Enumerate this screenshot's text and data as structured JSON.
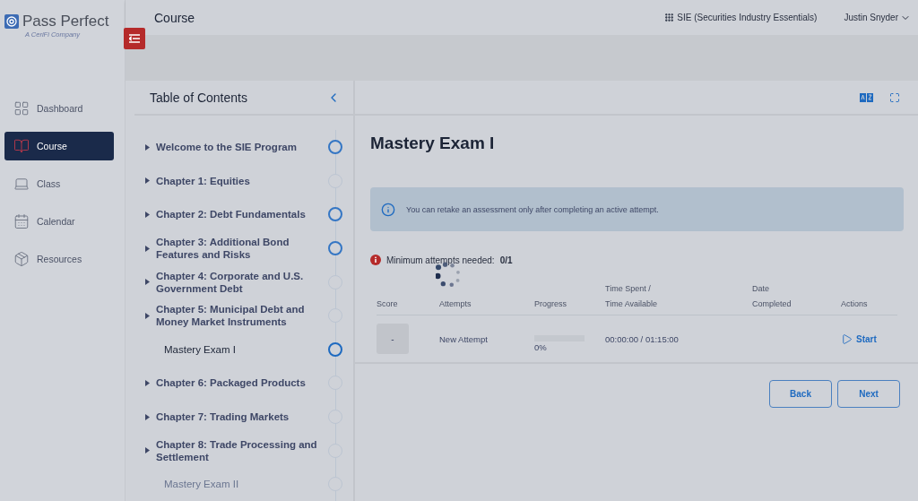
{
  "brand": {
    "name": "Pass Perfect",
    "tagline": "A CeriFi Company"
  },
  "header": {
    "title": "Course",
    "program": "SIE (Securities Industry Essentials)",
    "user": "Justin Snyder"
  },
  "nav": [
    {
      "label": "Dashboard",
      "kind": "dashboard",
      "selected": false
    },
    {
      "label": "Course",
      "kind": "course",
      "selected": true
    },
    {
      "label": "Class",
      "kind": "class",
      "selected": false
    },
    {
      "label": "Calendar",
      "kind": "calendar",
      "selected": false
    },
    {
      "label": "Resources",
      "kind": "resources",
      "selected": false
    }
  ],
  "toc": {
    "title": "Table of Contents",
    "items": [
      {
        "label": "Welcome to the SIE Program",
        "kind": "chapter",
        "visited": true,
        "selected": false,
        "disabled": false
      },
      {
        "label": "Chapter 1: Equities",
        "kind": "chapter",
        "visited": false,
        "selected": false,
        "disabled": false
      },
      {
        "label": "Chapter 2: Debt Fundamentals",
        "kind": "chapter",
        "visited": true,
        "selected": false,
        "disabled": false
      },
      {
        "label": "Chapter 3: Additional Bond Features and Risks",
        "kind": "chapter",
        "visited": true,
        "selected": false,
        "disabled": false
      },
      {
        "label": "Chapter 4: Corporate and U.S. Government Debt",
        "kind": "chapter",
        "visited": false,
        "selected": false,
        "disabled": false
      },
      {
        "label": "Chapter 5: Municipal Debt and Money Market Instruments",
        "kind": "chapter",
        "visited": false,
        "selected": false,
        "disabled": false
      },
      {
        "label": "Mastery Exam I",
        "kind": "exam",
        "visited": true,
        "selected": true,
        "disabled": false
      },
      {
        "label": "Chapter 6: Packaged Products",
        "kind": "chapter",
        "visited": false,
        "selected": false,
        "disabled": false
      },
      {
        "label": "Chapter 7: Trading Markets",
        "kind": "chapter",
        "visited": false,
        "selected": false,
        "disabled": false
      },
      {
        "label": "Chapter 8: Trade Processing and Settlement",
        "kind": "chapter",
        "visited": false,
        "selected": false,
        "disabled": false
      },
      {
        "label": "Mastery Exam II",
        "kind": "exam",
        "visited": false,
        "selected": false,
        "disabled": true
      }
    ]
  },
  "content": {
    "title": "Mastery Exam I",
    "notice": "You can retake an assessment only after completing an active attempt.",
    "minimum": {
      "label": "Minimum attempts needed:",
      "value": "0/1"
    },
    "columns": [
      {
        "line2": "Score"
      },
      {
        "line2": "Attempts"
      },
      {
        "line2": "Progress"
      },
      {
        "line1": "Time Spent /",
        "line2": "Time Available"
      },
      {
        "line1": "Date",
        "line2": "Completed"
      },
      {
        "line2": "Actions"
      }
    ],
    "rows": [
      {
        "score": "-",
        "attempt": "New Attempt",
        "level": 0,
        "progress": "0%",
        "time": "00:00:00 / 01:15:00",
        "action": "Start"
      }
    ],
    "buttons": [
      "Back",
      "Next"
    ]
  }
}
